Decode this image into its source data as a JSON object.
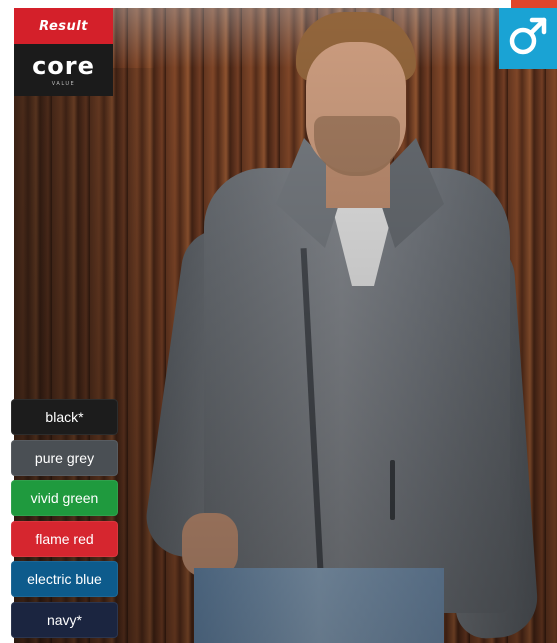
{
  "brand": {
    "result_label": "Result",
    "core_label": "core",
    "core_sub": "VALUE"
  },
  "gender": {
    "icon": "male-icon",
    "badge_color": "#1aa3d4"
  },
  "swatches": [
    {
      "label": "black*",
      "color": "#1c1c1c"
    },
    {
      "label": "pure grey",
      "color": "#4a4f54"
    },
    {
      "label": "vivid green",
      "color": "#1f9a3e"
    },
    {
      "label": "flame red",
      "color": "#d6262f"
    },
    {
      "label": "electric blue",
      "color": "#0d5b8c"
    },
    {
      "label": "navy*",
      "color": "#1b2540"
    }
  ]
}
